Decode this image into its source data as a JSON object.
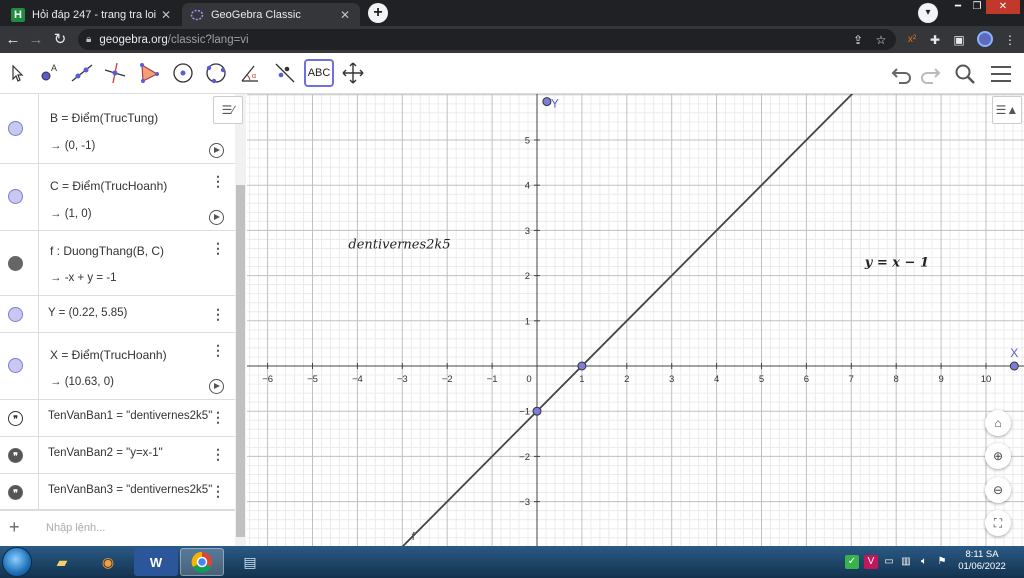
{
  "browser": {
    "tabs": [
      {
        "title": "Hỏi đáp 247 - trang tra loi",
        "favicon": "H"
      },
      {
        "title": "GeoGebra Classic",
        "favicon": "ggb"
      }
    ],
    "url_domain": "geogebra.org",
    "url_path": "/classic?lang=vi"
  },
  "toolbar": {
    "tools": [
      "move-tool",
      "point-tool",
      "line-tool",
      "perpendicular-line-tool",
      "polygon-tool",
      "circle-center-point-tool",
      "circle-three-points-tool",
      "angle-tool",
      "reflect-tool",
      "text-tool",
      "move-graphics-view-tool"
    ],
    "text_tool_label": "ABC"
  },
  "algebra": {
    "rows": [
      {
        "definition": "B  =  Điểm(TrucTung)",
        "output": "→  (0, -1)"
      },
      {
        "definition": "C  =  Điểm(TrucHoanh)",
        "output": "→  (1, 0)"
      },
      {
        "definition": "f : DuongThang(B, C)",
        "output": "→  -x + y = -1"
      },
      {
        "definition": "Y = (0.22, 5.85)"
      },
      {
        "definition": "X  =  Điểm(TrucHoanh)",
        "output": "→  (10.63, 0)"
      },
      {
        "definition": "TenVanBan1 = \"dentivernes2k5\""
      },
      {
        "definition": "TenVanBan2 = \"y=x-1\""
      },
      {
        "definition": "TenVanBan3 = \"dentivernes2k5\""
      }
    ],
    "input_placeholder": "Nhập lệnh..."
  },
  "graphics": {
    "x_ticks": [
      "−6",
      "−5",
      "−4",
      "−3",
      "−2",
      "−1",
      "0",
      "1",
      "2",
      "3",
      "4",
      "5",
      "6",
      "7",
      "8",
      "9",
      "10"
    ],
    "y_ticks": [
      "5",
      "4",
      "3",
      "2",
      "1",
      "−1",
      "−2",
      "−3"
    ],
    "text1": "dentivernes2k5",
    "text2": "y = x − 1",
    "label_Y": "Y",
    "label_X": "X",
    "label_f": "f",
    "line_color": "#444444",
    "point_color": "#7d7dd9"
  },
  "chart_data": {
    "type": "line",
    "title": "",
    "xlabel": "",
    "ylabel": "",
    "xlim": [
      -6.4,
      10.9
    ],
    "ylim": [
      -3.9,
      6.1
    ],
    "grid": true,
    "series": [
      {
        "name": "f",
        "x": [
          -3.1,
          7.1
        ],
        "y": [
          -4.1,
          6.1
        ]
      }
    ],
    "points": [
      {
        "name": "B",
        "x": 0,
        "y": -1
      },
      {
        "name": "C",
        "x": 1,
        "y": 0
      },
      {
        "name": "Y",
        "x": 0.22,
        "y": 5.85
      },
      {
        "name": "X",
        "x": 10.63,
        "y": 0
      }
    ],
    "annotations": [
      "dentivernes2k5",
      "y = x − 1"
    ]
  },
  "taskbar": {
    "time": "8:11 SA",
    "date": "01/06/2022"
  }
}
